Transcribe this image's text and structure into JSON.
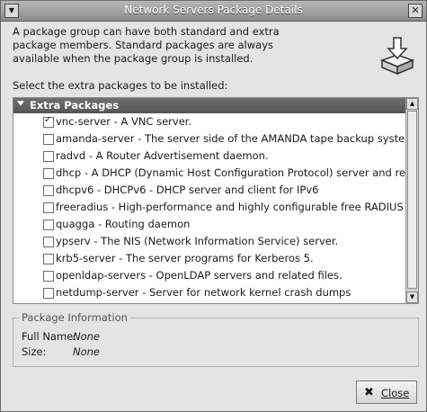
{
  "window": {
    "title": "Network Servers Package Details"
  },
  "description": "A package group can have both standard and extra package members.  Standard packages are always available when the package group is installed.",
  "select_label": "Select the extra packages to be installed:",
  "group": {
    "title": "Extra Packages"
  },
  "packages": [
    {
      "label": "vnc-server - A VNC server.",
      "checked": true
    },
    {
      "label": "amanda-server - The server side of the AMANDA tape backup system.",
      "checked": false
    },
    {
      "label": "radvd - A Router Advertisement daemon.",
      "checked": false
    },
    {
      "label": "dhcp - A DHCP (Dynamic Host Configuration Protocol) server and relay agent.",
      "checked": false
    },
    {
      "label": "dhcpv6 - DHCPv6 - DHCP server and client for IPv6",
      "checked": false
    },
    {
      "label": "freeradius - High-performance and highly configurable free RADIUS server.",
      "checked": false
    },
    {
      "label": "quagga - Routing daemon",
      "checked": false
    },
    {
      "label": "ypserv - The NIS (Network Information Service) server.",
      "checked": false
    },
    {
      "label": "krb5-server - The server programs for Kerberos 5.",
      "checked": false
    },
    {
      "label": "openldap-servers - OpenLDAP servers and related files.",
      "checked": false
    },
    {
      "label": "netdump-server - Server for network kernel crash dumps",
      "checked": false
    }
  ],
  "info": {
    "legend": "Package Information",
    "full_name_label": "Full Name:",
    "full_name_value": "None",
    "size_label": "Size:",
    "size_value": "None"
  },
  "close_button": {
    "label": "Close"
  },
  "icons": {
    "menu": "window-menu-icon",
    "close": "window-close-icon",
    "package": "package-install-icon"
  }
}
